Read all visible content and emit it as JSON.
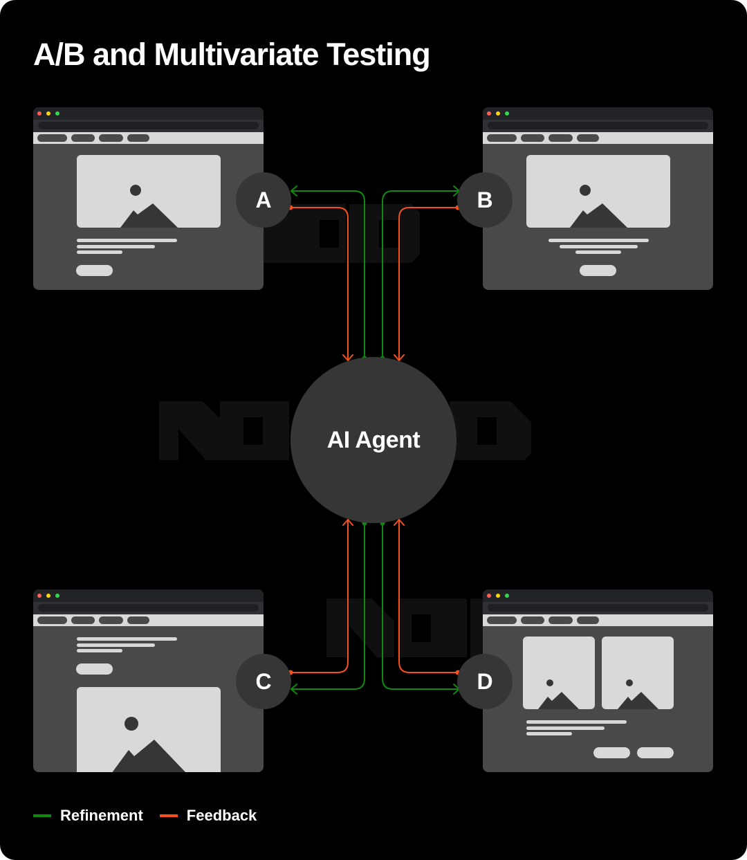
{
  "title": "A/B and Multivariate Testing",
  "center_node": {
    "label": "AI Agent"
  },
  "variants": [
    {
      "id": "A",
      "label": "A",
      "layout": "hero-image-top, left-aligned text, single button"
    },
    {
      "id": "B",
      "label": "B",
      "layout": "hero-image-top, centered text, centered button"
    },
    {
      "id": "C",
      "label": "C",
      "layout": "text and button first, image below"
    },
    {
      "id": "D",
      "label": "D",
      "layout": "two images side by side, text, two buttons"
    }
  ],
  "connections": [
    {
      "from": "AI Agent",
      "to": "A",
      "type": "Refinement"
    },
    {
      "from": "A",
      "to": "AI Agent",
      "type": "Feedback"
    },
    {
      "from": "AI Agent",
      "to": "B",
      "type": "Refinement"
    },
    {
      "from": "B",
      "to": "AI Agent",
      "type": "Feedback"
    },
    {
      "from": "AI Agent",
      "to": "C",
      "type": "Refinement"
    },
    {
      "from": "C",
      "to": "AI Agent",
      "type": "Feedback"
    },
    {
      "from": "AI Agent",
      "to": "D",
      "type": "Refinement"
    },
    {
      "from": "D",
      "to": "AI Agent",
      "type": "Feedback"
    }
  ],
  "legend": [
    {
      "label": "Refinement",
      "color": "#0f8a0f"
    },
    {
      "label": "Feedback",
      "color": "#f4511e"
    }
  ],
  "colors": {
    "background": "#000000",
    "node": "#363636",
    "refinement": "#0f8a0f",
    "feedback": "#f4511e",
    "window_close": "#ff5f57",
    "window_minimize": "#ffd60a",
    "window_zoom": "#32d74b"
  },
  "watermark": "NODD"
}
